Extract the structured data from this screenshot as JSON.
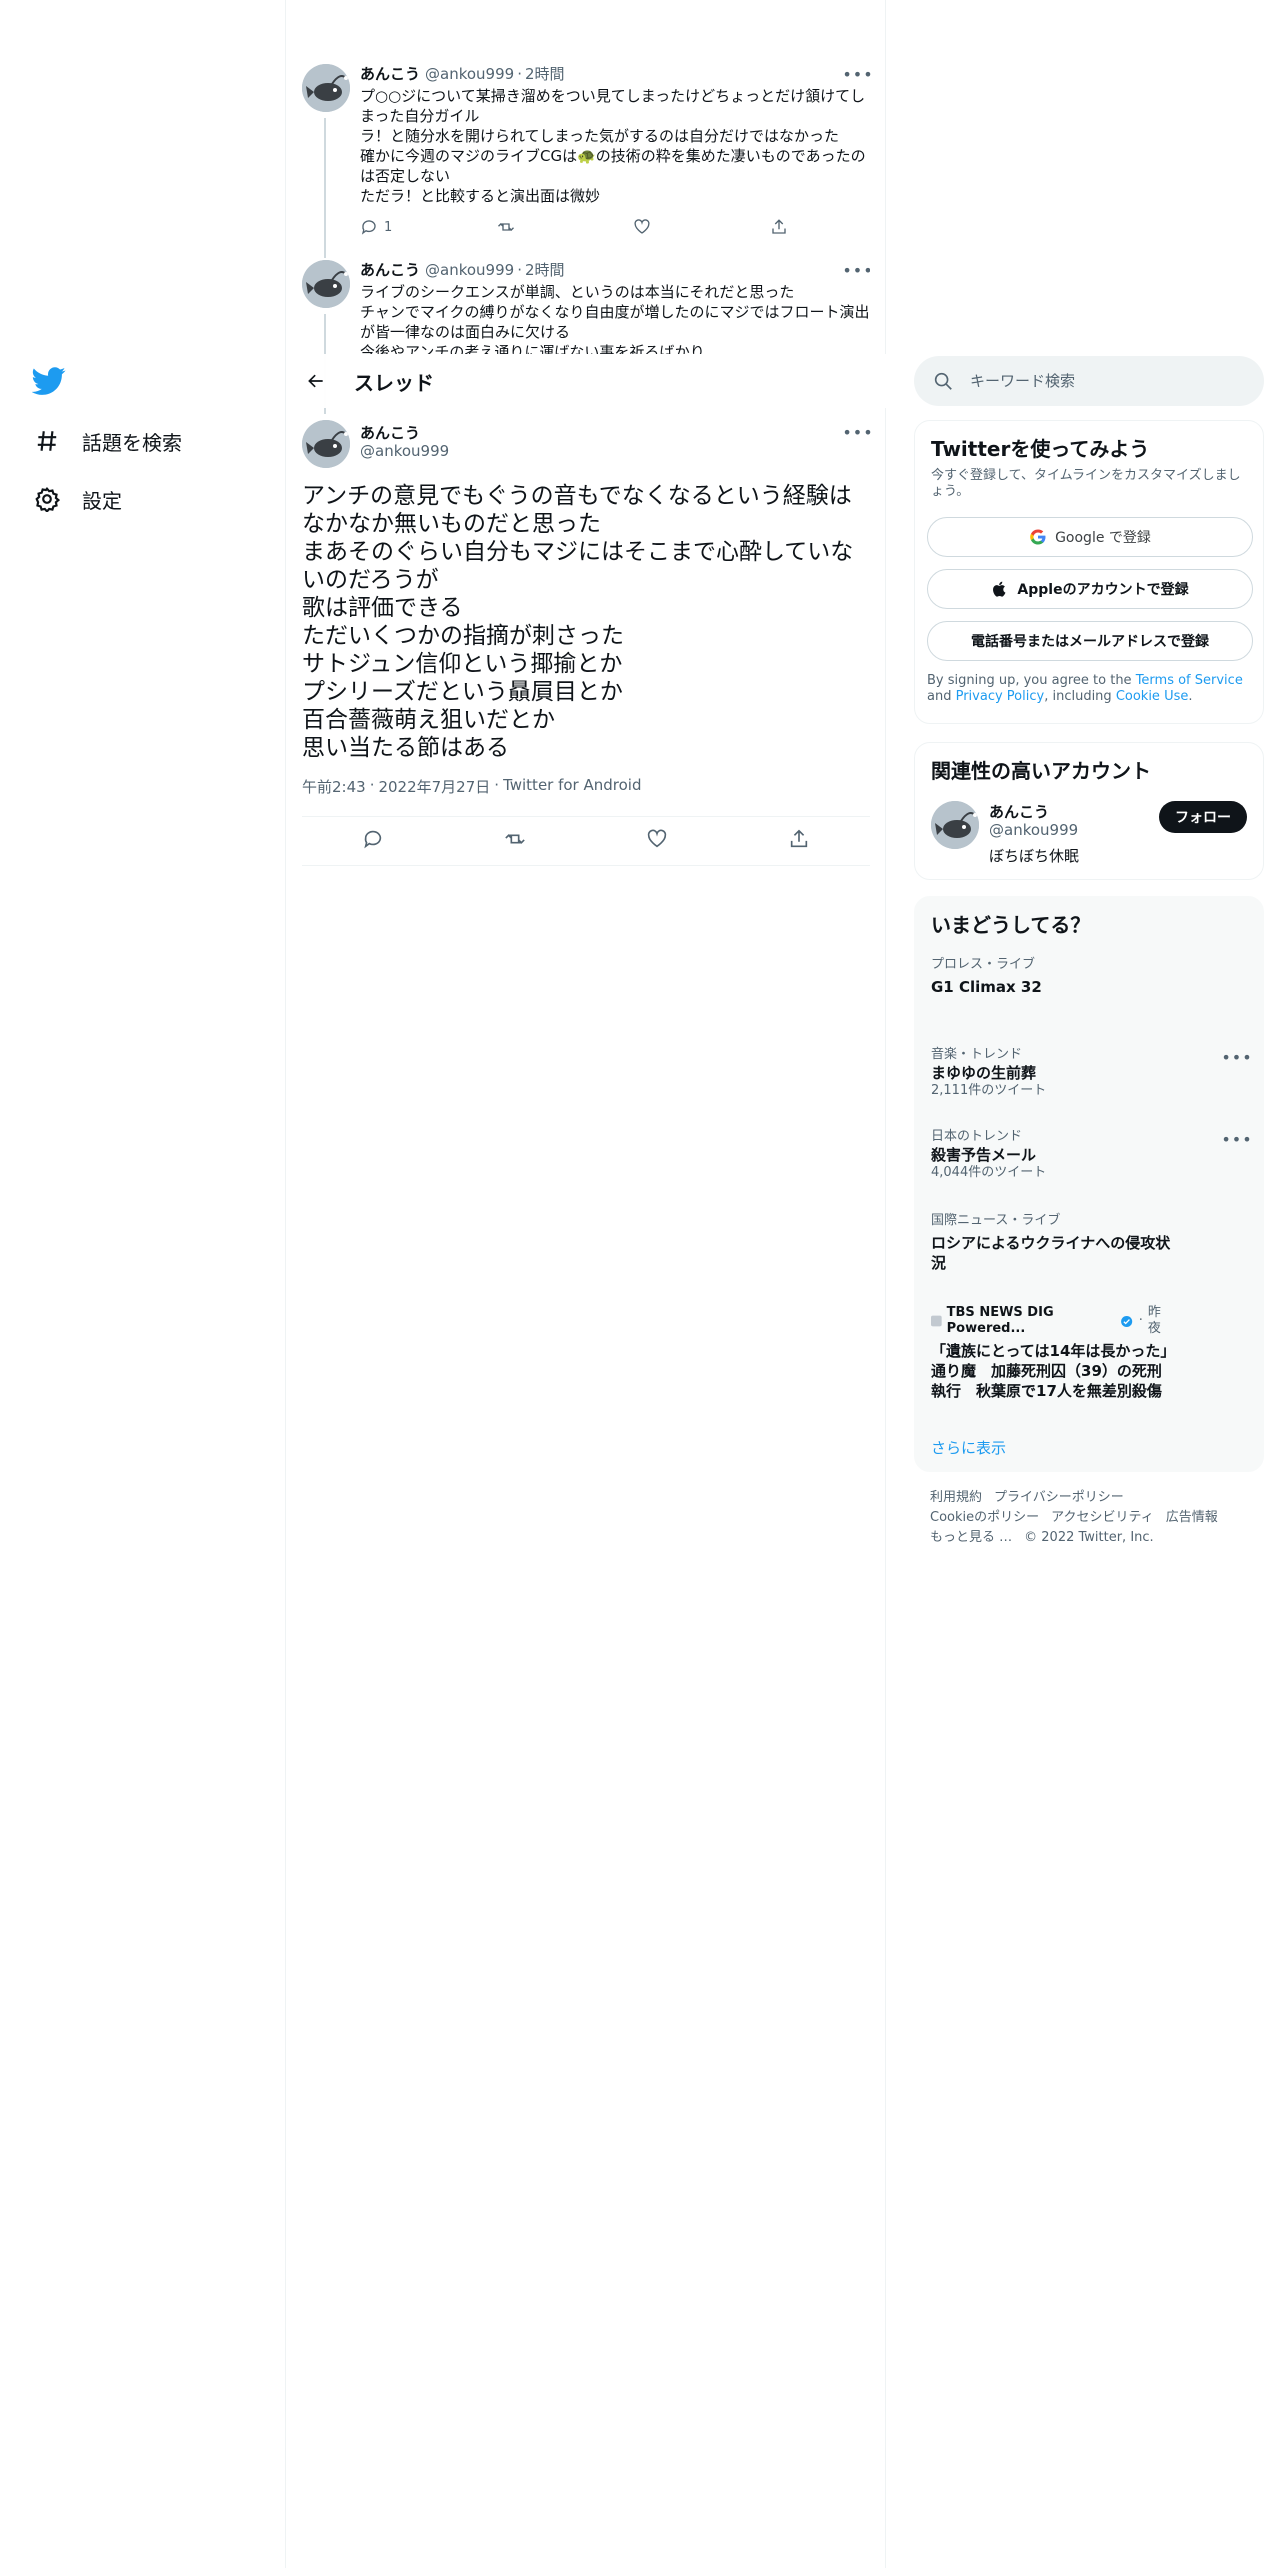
{
  "nav": {
    "items": [
      {
        "label": "話題を検索",
        "icon": "hash-icon"
      },
      {
        "label": "設定",
        "icon": "gear-icon"
      }
    ]
  },
  "prev_tweets": [
    {
      "name": "あんこう",
      "handle": "@ankou999",
      "dot": "·",
      "time": "2時間",
      "text": "プ○○ジについて某掃き溜めをつい見てしまったけどちょっとだけ頷けてしまった自分ガイル\nラ！と随分水を開けられてしまった気がするのは自分だけではなかった\n確かに今週のマジのライブCGは🐢の技術の粋を集めた凄いものであったのは否定しない\nただラ！と比較すると演出面は微妙",
      "reply_count": "1"
    },
    {
      "name": "あんこう",
      "handle": "@ankou999",
      "dot": "·",
      "time": "2時間",
      "text": "ライブのシークエンスが単調、というのは本当にそれだと思った\nチャンでマイクの縛りがなくなり自由度が増したのにマジではフロート演出が皆一律なのは面白みに欠ける\n今後やアンチの考え通りに運ばない事を祈るばかり"
    }
  ],
  "thread": {
    "title": "スレッド"
  },
  "main_tweet": {
    "name": "あんこう",
    "handle": "@ankou999",
    "text": "アンチの意見でもぐうの音もでなくなるという経験はなかなか無いものだと思った\nまあそのぐらい自分もマジにはそこまで心酔していないのだろうが\n歌は評価できる\nただいくつかの指摘が刺さった\nサトジュン信仰という揶揄とか\nプシリーズだという贔屓目とか\n百合薔薇萌え狙いだとか\n思い当たる節はある",
    "time": "午前2:43",
    "dot1": "·",
    "date": "2022年7月27日",
    "dot2": "·",
    "source": "Twitter for Android"
  },
  "search": {
    "placeholder": "キーワード検索"
  },
  "signup": {
    "title": "Twitterを使ってみよう",
    "subtitle": "今すぐ登録して、タイムラインをカスタマイズしましょう。",
    "google_label": "Google で登録",
    "apple_label": "Appleのアカウントで登録",
    "phone_label": "電話番号またはメールアドレスで登録",
    "terms_pre": "By signing up, you agree to the ",
    "terms_link": "Terms of Service",
    "terms_and": " and ",
    "privacy_link": "Privacy Policy",
    "terms_including": ", including ",
    "cookie_link": "Cookie Use",
    "terms_end": "."
  },
  "related": {
    "title": "関連性の高いアカウント",
    "name": "あんこう",
    "handle": "@ankou999",
    "bio": "ぼちぼち休眠",
    "follow_label": "フォロー"
  },
  "trends": {
    "title": "いまどうしてる？",
    "items": [
      {
        "category": "プロレス・ライブ",
        "title": "G1 Climax 32"
      },
      {
        "category": "音楽・トレンド",
        "title": "まゆゆの生前葬",
        "count": "2,111件のツイート"
      },
      {
        "category": "日本のトレンド",
        "title": "殺害予告メール",
        "count": "4,044件のツイート"
      },
      {
        "category": "国際ニュース・ライブ",
        "title": "ロシアによるウクライナへの侵攻状況"
      }
    ],
    "news": {
      "source": "TBS NEWS DIG Powered...",
      "dot": "·",
      "time": "昨夜",
      "title": "「遺族にとっては14年は長かった」通り魔　加藤死刑囚（39）の死刑執行　秋葉原で17人を無差別殺傷"
    },
    "show_more": "さらに表示"
  },
  "footer": {
    "links": [
      "利用規約",
      "プライバシーポリシー",
      "Cookieのポリシー",
      "アクセシビリティ",
      "広告情報",
      "もっと見る …",
      "© 2022 Twitter, Inc."
    ]
  },
  "colors": {
    "accent": "#1d9bf0",
    "text": "#0f1419",
    "secondary": "#536471",
    "border": "#eff3f4"
  }
}
